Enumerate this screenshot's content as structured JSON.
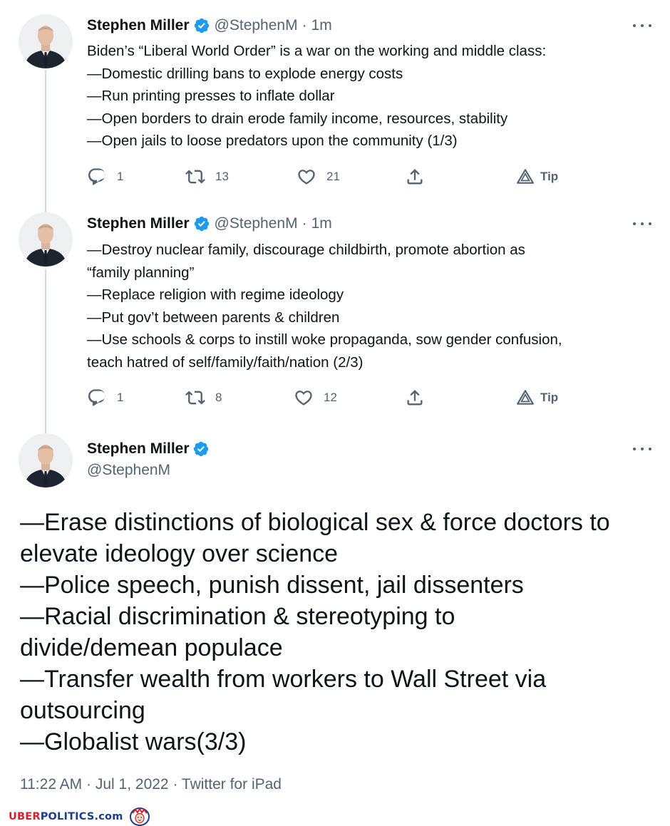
{
  "tweets": [
    {
      "author": "Stephen Miller",
      "handle": "@StephenM",
      "separator": "·",
      "time": "1m",
      "lines": [
        "Biden’s “Liberal World Order” is a war on the working and middle class:",
        "—Domestic drilling bans to explode energy costs",
        "—Run printing presses to inflate dollar",
        "—Open borders to drain erode family income, resources, stability",
        "—Open jails to loose predators upon the community (1/3)"
      ],
      "replies": "1",
      "retweets": "13",
      "likes": "21",
      "tip_label": "Tip"
    },
    {
      "author": "Stephen Miller",
      "handle": "@StephenM",
      "separator": "·",
      "time": "1m",
      "lines": [
        "—Destroy nuclear family, discourage childbirth, promote abortion as",
        "“family planning”",
        "—Replace religion with regime ideology",
        "—Put gov’t between parents & children",
        "—Use schools & corps to instill woke propaganda, sow gender confusion,",
        "teach hatred of self/family/faith/nation (2/3)"
      ],
      "replies": "1",
      "retweets": "8",
      "likes": "12",
      "tip_label": "Tip"
    }
  ],
  "main_tweet": {
    "author": "Stephen Miller",
    "handle": "@StephenM",
    "lines": [
      "—Erase distinctions of biological sex & force doctors to",
      "elevate ideology over science",
      "—Police speech, punish dissent, jail dissenters",
      "—Racial discrimination & stereotyping to",
      "divide/demean populace",
      "—Transfer wealth from workers to Wall Street via",
      "outsourcing",
      "—Globalist wars(3/3)"
    ],
    "time": "11:22 AM",
    "date": "Jul 1, 2022",
    "client": "Twitter for iPad",
    "separator": "·"
  },
  "watermark": {
    "part1": "UBER",
    "part2": "POLITICS",
    "part3": ".com"
  },
  "colors": {
    "verified": "#1d9bf0",
    "secondary_text": "#536471",
    "thread_line": "#cfd9de"
  },
  "icons": [
    "reply-icon",
    "retweet-icon",
    "like-icon",
    "share-icon",
    "tip-icon",
    "verified-badge-icon",
    "more-icon",
    "lion-logo-icon"
  ]
}
